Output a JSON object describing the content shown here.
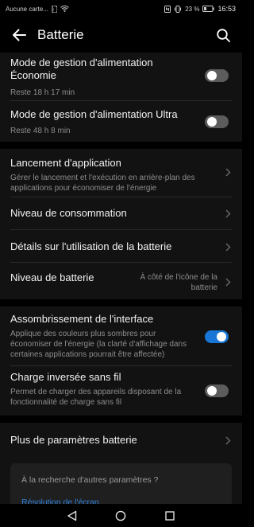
{
  "status_bar": {
    "carrier": "Aucune carte...",
    "battery_percent": "23 %",
    "time": "16:53",
    "icons": [
      "sim-icon",
      "wifi-icon",
      "nfc-icon",
      "vibrate-icon",
      "battery-icon"
    ]
  },
  "app_bar": {
    "title": "Batterie",
    "back_icon": "back-arrow-icon",
    "search_icon": "search-icon"
  },
  "sections": {
    "power_modes": {
      "eco": {
        "title": "Mode de gestion d'alimentation Économie",
        "subtitle": "Reste 18 h 17 min",
        "enabled": false
      },
      "ultra": {
        "title": "Mode de gestion d'alimentation Ultra",
        "subtitle": "Reste 48 h 8 min",
        "enabled": false
      }
    },
    "navigation": {
      "app_launch": {
        "title": "Lancement d'application",
        "subtitle": "Gérer le lancement et l'exécution en arrière-plan des applications pour économiser de l'énergie"
      },
      "consumption": {
        "title": "Niveau de consommation"
      },
      "usage_details": {
        "title": "Détails sur l'utilisation de la batterie"
      },
      "battery_level": {
        "title": "Niveau de batterie",
        "value": "À côté de l'icône de la batterie"
      }
    },
    "display": {
      "dark_interface": {
        "title": "Assombrissement de l'interface",
        "subtitle": "Applique des couleurs plus sombres pour économiser de l'énergie (la clarté d'affichage dans certaines applications pourrait être affectée)",
        "enabled": true
      },
      "reverse_charge": {
        "title": "Charge inversée sans fil",
        "subtitle": "Permet de charger des appareils disposant de la fonctionnalité de charge sans fil",
        "enabled": false
      }
    },
    "more": {
      "title": "Plus de paramètres batterie"
    }
  },
  "suggestion_card": {
    "title": "À la recherche d'autres paramètres ?",
    "link": "Résolution de l'écran"
  },
  "colors": {
    "accent": "#1877d6",
    "background": "#121212",
    "toggle_off": "#5c5c5c"
  }
}
